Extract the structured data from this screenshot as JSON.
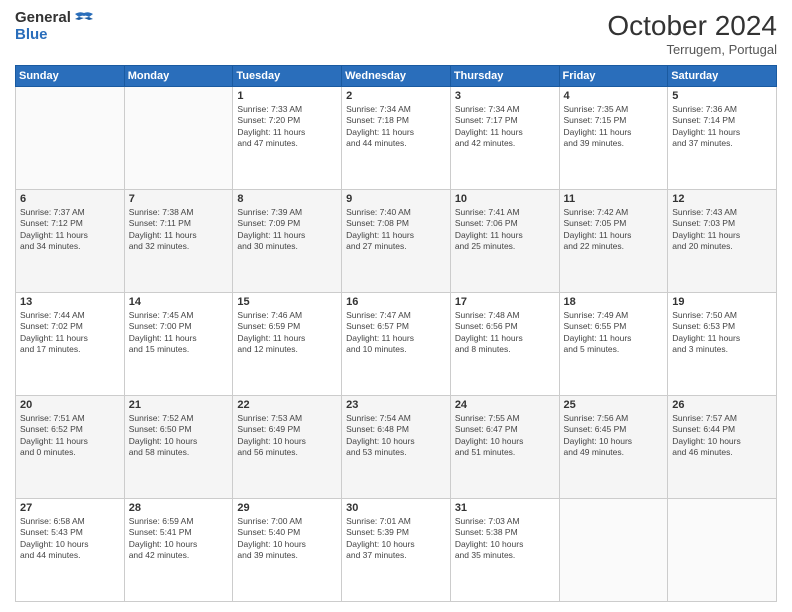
{
  "header": {
    "logo_line1": "General",
    "logo_line2": "Blue",
    "month_year": "October 2024",
    "location": "Terrugem, Portugal"
  },
  "days_of_week": [
    "Sunday",
    "Monday",
    "Tuesday",
    "Wednesday",
    "Thursday",
    "Friday",
    "Saturday"
  ],
  "weeks": [
    [
      {
        "day": "",
        "lines": []
      },
      {
        "day": "",
        "lines": []
      },
      {
        "day": "1",
        "lines": [
          "Sunrise: 7:33 AM",
          "Sunset: 7:20 PM",
          "Daylight: 11 hours",
          "and 47 minutes."
        ]
      },
      {
        "day": "2",
        "lines": [
          "Sunrise: 7:34 AM",
          "Sunset: 7:18 PM",
          "Daylight: 11 hours",
          "and 44 minutes."
        ]
      },
      {
        "day": "3",
        "lines": [
          "Sunrise: 7:34 AM",
          "Sunset: 7:17 PM",
          "Daylight: 11 hours",
          "and 42 minutes."
        ]
      },
      {
        "day": "4",
        "lines": [
          "Sunrise: 7:35 AM",
          "Sunset: 7:15 PM",
          "Daylight: 11 hours",
          "and 39 minutes."
        ]
      },
      {
        "day": "5",
        "lines": [
          "Sunrise: 7:36 AM",
          "Sunset: 7:14 PM",
          "Daylight: 11 hours",
          "and 37 minutes."
        ]
      }
    ],
    [
      {
        "day": "6",
        "lines": [
          "Sunrise: 7:37 AM",
          "Sunset: 7:12 PM",
          "Daylight: 11 hours",
          "and 34 minutes."
        ]
      },
      {
        "day": "7",
        "lines": [
          "Sunrise: 7:38 AM",
          "Sunset: 7:11 PM",
          "Daylight: 11 hours",
          "and 32 minutes."
        ]
      },
      {
        "day": "8",
        "lines": [
          "Sunrise: 7:39 AM",
          "Sunset: 7:09 PM",
          "Daylight: 11 hours",
          "and 30 minutes."
        ]
      },
      {
        "day": "9",
        "lines": [
          "Sunrise: 7:40 AM",
          "Sunset: 7:08 PM",
          "Daylight: 11 hours",
          "and 27 minutes."
        ]
      },
      {
        "day": "10",
        "lines": [
          "Sunrise: 7:41 AM",
          "Sunset: 7:06 PM",
          "Daylight: 11 hours",
          "and 25 minutes."
        ]
      },
      {
        "day": "11",
        "lines": [
          "Sunrise: 7:42 AM",
          "Sunset: 7:05 PM",
          "Daylight: 11 hours",
          "and 22 minutes."
        ]
      },
      {
        "day": "12",
        "lines": [
          "Sunrise: 7:43 AM",
          "Sunset: 7:03 PM",
          "Daylight: 11 hours",
          "and 20 minutes."
        ]
      }
    ],
    [
      {
        "day": "13",
        "lines": [
          "Sunrise: 7:44 AM",
          "Sunset: 7:02 PM",
          "Daylight: 11 hours",
          "and 17 minutes."
        ]
      },
      {
        "day": "14",
        "lines": [
          "Sunrise: 7:45 AM",
          "Sunset: 7:00 PM",
          "Daylight: 11 hours",
          "and 15 minutes."
        ]
      },
      {
        "day": "15",
        "lines": [
          "Sunrise: 7:46 AM",
          "Sunset: 6:59 PM",
          "Daylight: 11 hours",
          "and 12 minutes."
        ]
      },
      {
        "day": "16",
        "lines": [
          "Sunrise: 7:47 AM",
          "Sunset: 6:57 PM",
          "Daylight: 11 hours",
          "and 10 minutes."
        ]
      },
      {
        "day": "17",
        "lines": [
          "Sunrise: 7:48 AM",
          "Sunset: 6:56 PM",
          "Daylight: 11 hours",
          "and 8 minutes."
        ]
      },
      {
        "day": "18",
        "lines": [
          "Sunrise: 7:49 AM",
          "Sunset: 6:55 PM",
          "Daylight: 11 hours",
          "and 5 minutes."
        ]
      },
      {
        "day": "19",
        "lines": [
          "Sunrise: 7:50 AM",
          "Sunset: 6:53 PM",
          "Daylight: 11 hours",
          "and 3 minutes."
        ]
      }
    ],
    [
      {
        "day": "20",
        "lines": [
          "Sunrise: 7:51 AM",
          "Sunset: 6:52 PM",
          "Daylight: 11 hours",
          "and 0 minutes."
        ]
      },
      {
        "day": "21",
        "lines": [
          "Sunrise: 7:52 AM",
          "Sunset: 6:50 PM",
          "Daylight: 10 hours",
          "and 58 minutes."
        ]
      },
      {
        "day": "22",
        "lines": [
          "Sunrise: 7:53 AM",
          "Sunset: 6:49 PM",
          "Daylight: 10 hours",
          "and 56 minutes."
        ]
      },
      {
        "day": "23",
        "lines": [
          "Sunrise: 7:54 AM",
          "Sunset: 6:48 PM",
          "Daylight: 10 hours",
          "and 53 minutes."
        ]
      },
      {
        "day": "24",
        "lines": [
          "Sunrise: 7:55 AM",
          "Sunset: 6:47 PM",
          "Daylight: 10 hours",
          "and 51 minutes."
        ]
      },
      {
        "day": "25",
        "lines": [
          "Sunrise: 7:56 AM",
          "Sunset: 6:45 PM",
          "Daylight: 10 hours",
          "and 49 minutes."
        ]
      },
      {
        "day": "26",
        "lines": [
          "Sunrise: 7:57 AM",
          "Sunset: 6:44 PM",
          "Daylight: 10 hours",
          "and 46 minutes."
        ]
      }
    ],
    [
      {
        "day": "27",
        "lines": [
          "Sunrise: 6:58 AM",
          "Sunset: 5:43 PM",
          "Daylight: 10 hours",
          "and 44 minutes."
        ]
      },
      {
        "day": "28",
        "lines": [
          "Sunrise: 6:59 AM",
          "Sunset: 5:41 PM",
          "Daylight: 10 hours",
          "and 42 minutes."
        ]
      },
      {
        "day": "29",
        "lines": [
          "Sunrise: 7:00 AM",
          "Sunset: 5:40 PM",
          "Daylight: 10 hours",
          "and 39 minutes."
        ]
      },
      {
        "day": "30",
        "lines": [
          "Sunrise: 7:01 AM",
          "Sunset: 5:39 PM",
          "Daylight: 10 hours",
          "and 37 minutes."
        ]
      },
      {
        "day": "31",
        "lines": [
          "Sunrise: 7:03 AM",
          "Sunset: 5:38 PM",
          "Daylight: 10 hours",
          "and 35 minutes."
        ]
      },
      {
        "day": "",
        "lines": []
      },
      {
        "day": "",
        "lines": []
      }
    ]
  ]
}
